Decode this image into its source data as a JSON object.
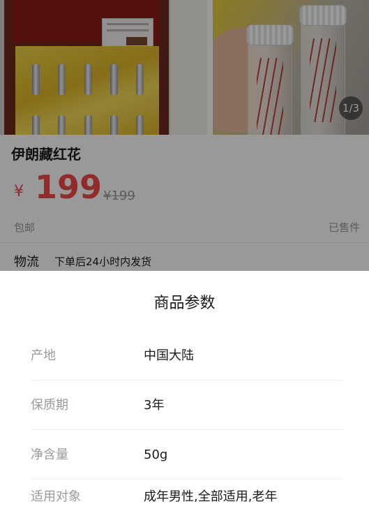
{
  "gallery": {
    "indicator": "1/3",
    "images": [
      {
        "name": "saffron-gift-box-photo"
      },
      {
        "name": "saffron-glass-tubes-photo"
      }
    ]
  },
  "product": {
    "title": "伊朗藏红花",
    "currency": "¥",
    "price": "199",
    "original_price": "¥199",
    "shipping": "包邮",
    "sold": "已售件"
  },
  "logistics": {
    "label": "物流",
    "text": "下单后24小时内发货"
  },
  "params_sheet": {
    "title": "商品参数",
    "rows": [
      {
        "label": "产地",
        "value": "中国大陆"
      },
      {
        "label": "保质期",
        "value": "3年"
      },
      {
        "label": "净含量",
        "value": "50g"
      },
      {
        "label": "适用对象",
        "value": "成年男性,全部适用,老年"
      }
    ]
  },
  "colors": {
    "price_red": "#f04a48",
    "overlay": "rgba(0,0,0,0.4)",
    "label_gray": "#9a9a9a",
    "text_dark": "#1a1a1a"
  }
}
